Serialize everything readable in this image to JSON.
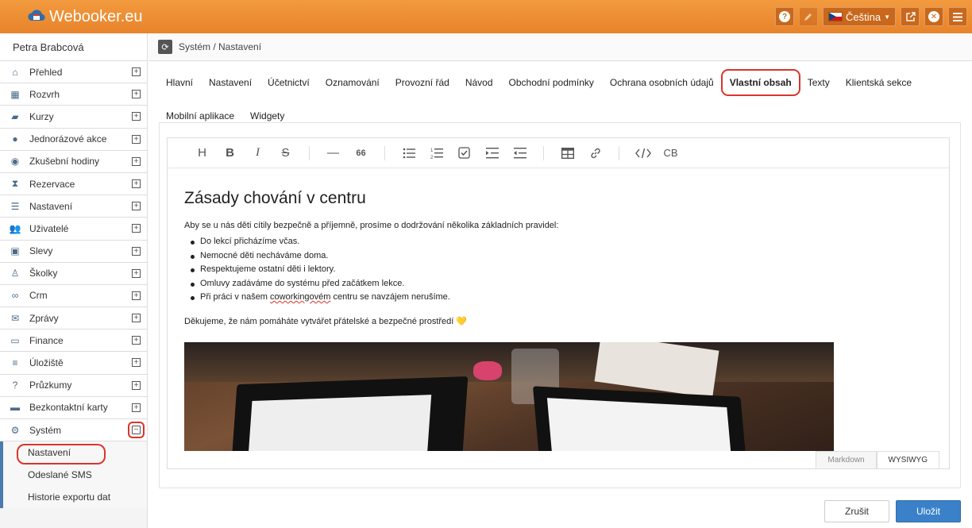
{
  "app": {
    "brand": "Webooker.eu",
    "language": "Čeština",
    "colors": {
      "topbar": "#e8832a",
      "primary": "#3a81c9",
      "highlight": "#d9352b"
    }
  },
  "topbar": {
    "help_icon": "question-circle-icon",
    "edit_icon": "pencil-icon",
    "external_icon": "external-link-icon",
    "close_icon": "close-circle-icon",
    "menu_icon": "hamburger-icon"
  },
  "sidebar": {
    "user_name": "Petra Brabcová",
    "items": [
      {
        "label": "Přehled",
        "icon": "home-icon"
      },
      {
        "label": "Rozvrh",
        "icon": "calendar-icon"
      },
      {
        "label": "Kurzy",
        "icon": "book-icon"
      },
      {
        "label": "Jednorázové akce",
        "icon": "ball-icon"
      },
      {
        "label": "Zkušební hodiny",
        "icon": "eye-slash-icon"
      },
      {
        "label": "Rezervace",
        "icon": "hourglass-icon"
      },
      {
        "label": "Nastavení",
        "icon": "settings-list-icon"
      },
      {
        "label": "Uživatelé",
        "icon": "users-icon"
      },
      {
        "label": "Slevy",
        "icon": "gift-icon"
      },
      {
        "label": "Školky",
        "icon": "child-icon"
      },
      {
        "label": "Crm",
        "icon": "handshake-icon"
      },
      {
        "label": "Zprávy",
        "icon": "envelope-icon"
      },
      {
        "label": "Finance",
        "icon": "money-icon"
      },
      {
        "label": "Úložiště",
        "icon": "database-icon"
      },
      {
        "label": "Průzkumy",
        "icon": "question-icon"
      },
      {
        "label": "Bezkontaktní karty",
        "icon": "card-icon"
      },
      {
        "label": "Systém",
        "icon": "cogs-icon",
        "expanded": true
      }
    ],
    "submenu": [
      {
        "label": "Nastavení",
        "active": true
      },
      {
        "label": "Odeslané SMS"
      },
      {
        "label": "Historie exportu dat"
      }
    ]
  },
  "main": {
    "breadcrumb": "Systém / Nastavení",
    "tabs": [
      {
        "label": "Hlavní"
      },
      {
        "label": "Nastavení"
      },
      {
        "label": "Účetnictví"
      },
      {
        "label": "Oznamování"
      },
      {
        "label": "Provozní řád"
      },
      {
        "label": "Návod"
      },
      {
        "label": "Obchodní podmínky"
      },
      {
        "label": "Ochrana osobních údajů"
      },
      {
        "label": "Vlastní obsah",
        "active": true
      },
      {
        "label": "Texty"
      },
      {
        "label": "Klientská sekce"
      },
      {
        "label": "Mobilní aplikace"
      },
      {
        "label": "Widgety"
      }
    ],
    "toolbar": {
      "heading": "H",
      "bold": "B",
      "italic": "I",
      "strike": "S",
      "hr": "—",
      "quote": "66",
      "code_block": "CB"
    },
    "document": {
      "title": "Zásady chování v centru",
      "intro": "Aby se u nás děti cítily bezpečně a příjemně, prosíme o dodržování několika základních pravidel:",
      "rules": [
        "Do lekcí přicházíme včas.",
        "Nemocné děti necháváme doma.",
        "Respektujeme ostatní děti i lektory.",
        "Omluvy zadáváme do systému před začátkem lekce."
      ],
      "last_rule_before": "Při práci v našem ",
      "last_rule_flagged": "coworkingovém",
      "last_rule_after": " centru se navzájem nerušíme.",
      "outro": "Děkujeme, že nám pomáháte vytvářet přátelské a bezpečné prostředí",
      "heart": "💛"
    },
    "modes": {
      "markdown": "Markdown",
      "wysiwyg": "WYSIWYG"
    },
    "actions": {
      "cancel": "Zrušit",
      "save": "Uložit"
    }
  }
}
